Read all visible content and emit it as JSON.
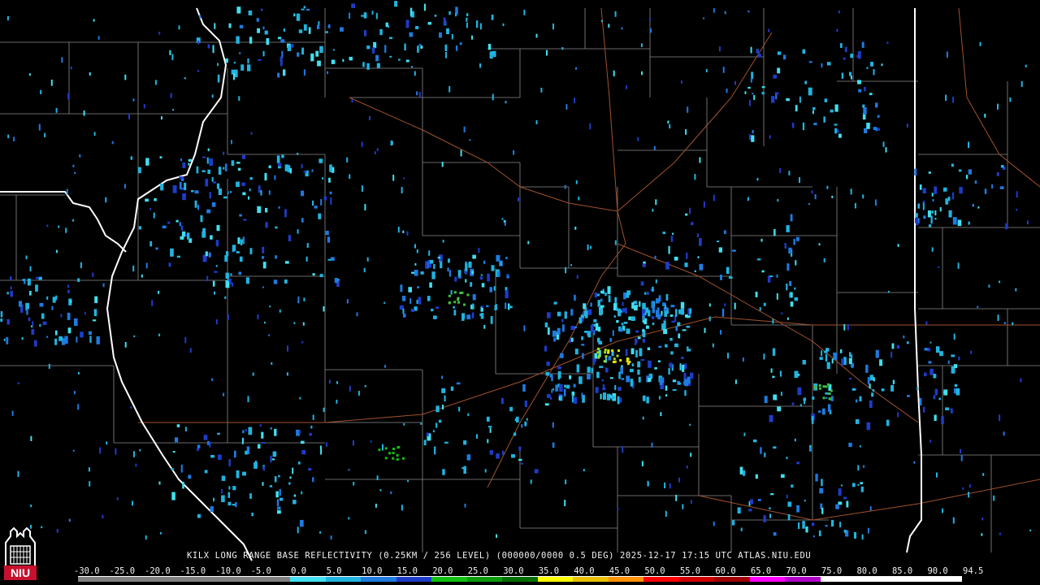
{
  "product_caption": "KILX LONG RANGE BASE REFLECTIVITY (0.25KM / 256 LEVEL) (000000/0000 0.5 DEG) 2025-12-17 17:15 UTC  ATLAS.NIU.EDU",
  "logo_text": "NIU",
  "scale_labels": [
    "-30.0",
    "-25.0",
    "-20.0",
    "-15.0",
    "-10.0",
    "-5.0",
    "0.0",
    "5.0",
    "10.0",
    "15.0",
    "20.0",
    "25.0",
    "30.0",
    "35.0",
    "40.0",
    "45.0",
    "50.0",
    "55.0",
    "60.0",
    "65.0",
    "70.0",
    "75.0",
    "80.0",
    "85.0",
    "90.0",
    "94.5"
  ],
  "colors": {
    "background": "#000000",
    "county_lines": "#8a8a8a",
    "state_lines": "#ffffff",
    "highways": "#a0522d",
    "logo_red": "#c8102e"
  },
  "scale_colors": [
    "#808080",
    "#808080",
    "#808080",
    "#808080",
    "#808080",
    "#808080",
    "#40e0f0",
    "#20b4e0",
    "#1e7be0",
    "#1e3cc8",
    "#10c010",
    "#0a9a0a",
    "#006e00",
    "#ffff00",
    "#e8c000",
    "#ff9000",
    "#ff0000",
    "#d00000",
    "#a00000",
    "#ff00ff",
    "#b000c8",
    "#ffffff",
    "#ffffff",
    "#ffffff",
    "#ffffff"
  ]
}
